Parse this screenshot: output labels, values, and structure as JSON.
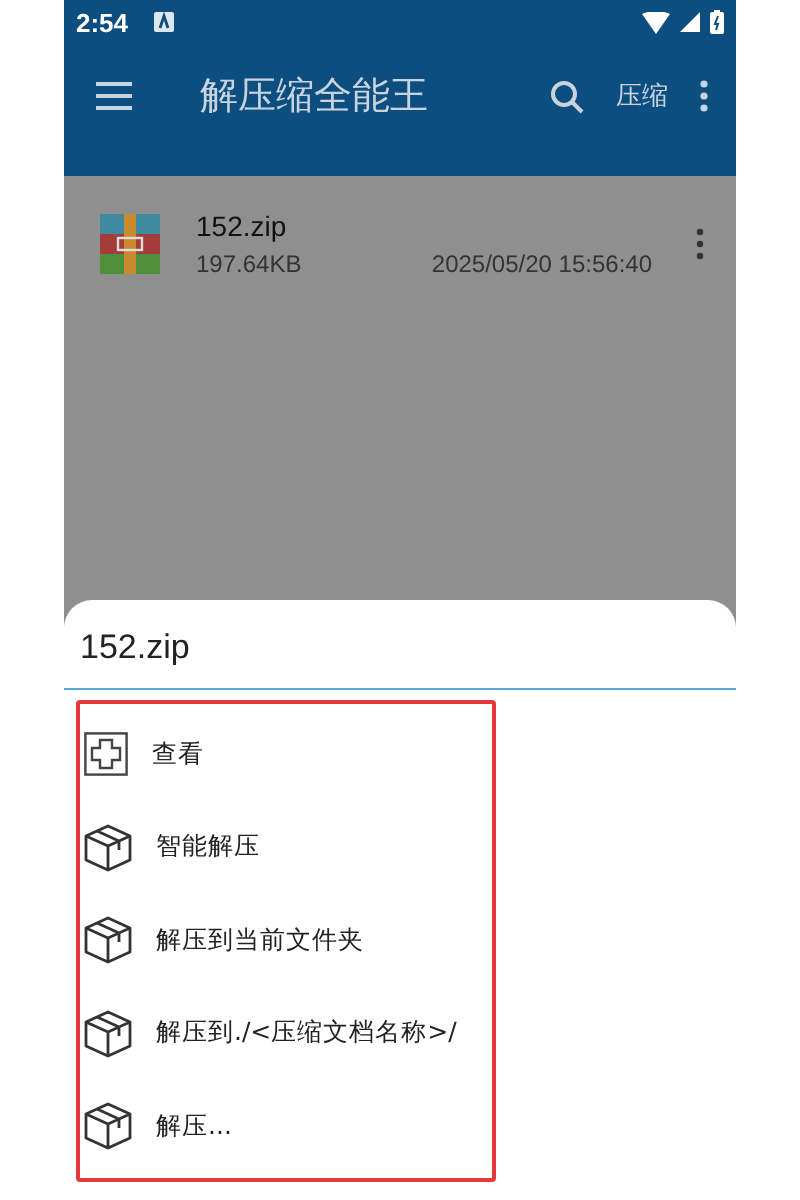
{
  "status_bar": {
    "time": "2:54"
  },
  "app_bar": {
    "title": "解压缩全能王",
    "action": "压缩"
  },
  "files": [
    {
      "name": "152.zip",
      "size": "197.64KB",
      "date": "2025/05/20 15:56:40"
    }
  ],
  "sheet": {
    "title": "152.zip",
    "items": [
      {
        "kind": "view",
        "label": "查看"
      },
      {
        "kind": "extract",
        "label": "智能解压"
      },
      {
        "kind": "extract",
        "label": "解压到当前文件夹"
      },
      {
        "kind": "extract",
        "label": "解压到./<压缩文档名称>/"
      },
      {
        "kind": "extract",
        "label": "解压..."
      }
    ]
  }
}
